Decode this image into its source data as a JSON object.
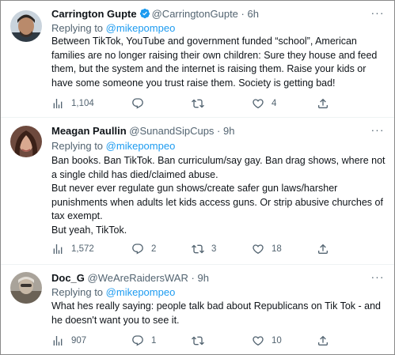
{
  "tweets": [
    {
      "name": "Carrington Gupte",
      "handle": "@CarringtonGupte",
      "time": "6h",
      "verified": true,
      "replying_prefix": "",
      "replying_to": "",
      "lines": [
        "Between TikTok, YouTube and government funded “school”, American",
        "families are no longer raising their own children: Sure they house and feed",
        "them, but the system and the internet is raising them. Raise your kids or",
        "have some someone you trust raise them. Society is getting bad!"
      ],
      "views": "1,104",
      "replies": "",
      "retweets": "",
      "likes": "4"
    },
    {
      "name": "Meagan Paullin",
      "handle": "@SunandSipCups",
      "time": "9h",
      "verified": false,
      "replying_prefix": "Replying to",
      "replying_to": "@mikepompeo",
      "lines": [
        "Ban books. Ban TikTok. Ban curriculum/say gay. Ban drag shows, where not",
        "a single child has died/claimed abuse.",
        "But never ever regulate gun shows/create safer gun laws/harsher",
        "punishments when adults let kids access guns. Or strip abusive churches of",
        "tax exempt.",
        "But yeah, TikTok."
      ],
      "views": "1,572",
      "replies": "2",
      "retweets": "3",
      "likes": "18"
    },
    {
      "name": "Doc_G",
      "handle": "@WeAreRaidersWAR",
      "time": "9h",
      "verified": false,
      "replying_prefix": "Replying to",
      "replying_to": "@mikepompeo",
      "lines": [
        "What hes really saying: people talk bad about Republicans on Tik Tok - and",
        "he doesn't want you to see it."
      ],
      "views": "907",
      "replies": "1",
      "retweets": "",
      "likes": "10"
    }
  ],
  "first_replying": {
    "prefix": "Replying to",
    "to": "@mikepompeo"
  },
  "sep": "·",
  "more_glyph": "···",
  "colors": {
    "accent": "#1d9bf0",
    "text": "#0f1419",
    "muted": "#536471",
    "divider": "#eff3f4"
  },
  "icons": [
    "verified-badge-icon",
    "more-options-icon",
    "views-icon",
    "reply-icon",
    "retweet-icon",
    "like-icon",
    "share-icon"
  ]
}
